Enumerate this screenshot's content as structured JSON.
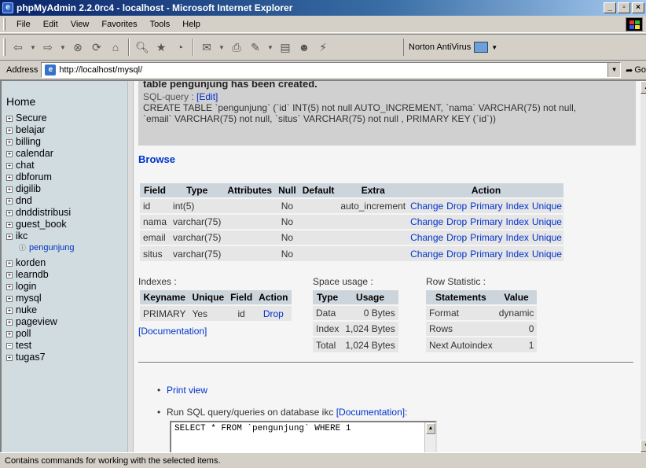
{
  "window": {
    "title": "phpMyAdmin 2.2.0rc4 - localhost - Microsoft Internet Explorer"
  },
  "menu": [
    "File",
    "Edit",
    "View",
    "Favorites",
    "Tools",
    "Help"
  ],
  "toolbar": {
    "norton": "Norton AntiVirus"
  },
  "address": {
    "label": "Address",
    "url": "http://localhost/mysql/",
    "go": "Go"
  },
  "sidebar": {
    "home": "Home",
    "databases": [
      "Secure",
      "belajar",
      "billing",
      "calendar",
      "chat",
      "dbforum",
      "digilib",
      "dnd",
      "dnddistribusi",
      "guest_book",
      "ikc"
    ],
    "sub_table": "pengunjung",
    "databases_after": [
      "korden",
      "learndb",
      "login",
      "mysql",
      "nuke",
      "pageview",
      "poll",
      "test",
      "tugas7"
    ]
  },
  "message": {
    "title": "table pengunjung has been created.",
    "sql_label": "SQL-query :",
    "edit": "[Edit]",
    "sql_line1": "CREATE TABLE `pengunjung` (`id` INT(5) not null AUTO_INCREMENT, `nama` VARCHAR(75) not null,",
    "sql_line2": "`email` VARCHAR(75) not null, `situs` VARCHAR(75) not null , PRIMARY KEY (`id`))"
  },
  "browse": "Browse",
  "fields_table": {
    "headers": [
      "Field",
      "Type",
      "Attributes",
      "Null",
      "Default",
      "Extra",
      "Action"
    ],
    "actions": [
      "Change",
      "Drop",
      "Primary",
      "Index",
      "Unique"
    ],
    "rows": [
      {
        "field": "id",
        "type": "int(5)",
        "attributes": "",
        "null": "No",
        "default": "",
        "extra": "auto_increment"
      },
      {
        "field": "nama",
        "type": "varchar(75)",
        "attributes": "",
        "null": "No",
        "default": "",
        "extra": ""
      },
      {
        "field": "email",
        "type": "varchar(75)",
        "attributes": "",
        "null": "No",
        "default": "",
        "extra": ""
      },
      {
        "field": "situs",
        "type": "varchar(75)",
        "attributes": "",
        "null": "No",
        "default": "",
        "extra": ""
      }
    ]
  },
  "indexes": {
    "label": "Indexes :",
    "headers": [
      "Keyname",
      "Unique",
      "Field",
      "Action"
    ],
    "row": {
      "keyname": "PRIMARY",
      "unique": "Yes",
      "field": "id",
      "action": "Drop"
    },
    "doc": "[Documentation]"
  },
  "space": {
    "label": "Space usage :",
    "headers": [
      "Type",
      "Usage"
    ],
    "rows": [
      {
        "type": "Data",
        "usage": "0 Bytes"
      },
      {
        "type": "Index",
        "usage": "1,024 Bytes"
      },
      {
        "type": "Total",
        "usage": "1,024 Bytes"
      }
    ]
  },
  "rowstat": {
    "label": "Row Statistic :",
    "headers": [
      "Statements",
      "Value"
    ],
    "rows": [
      {
        "statement": "Format",
        "value": "dynamic"
      },
      {
        "statement": "Rows",
        "value": "0"
      },
      {
        "statement": "Next Autoindex",
        "value": "1"
      }
    ]
  },
  "links": {
    "print_view": "Print view",
    "run_sql": "Run SQL query/queries on database ikc",
    "doc": "[Documentation]",
    "colon": " :"
  },
  "sqlbox": {
    "value": "SELECT * FROM `pengunjung` WHERE 1"
  },
  "status": "Contains commands for working with the selected items."
}
